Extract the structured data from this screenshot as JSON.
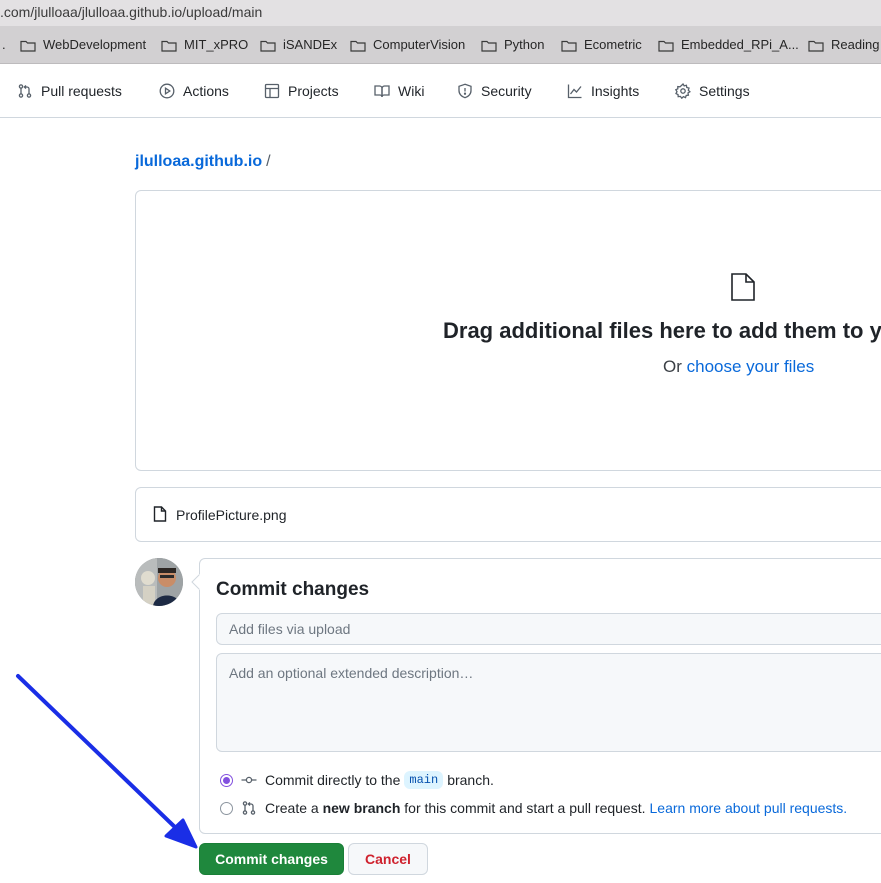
{
  "browser": {
    "url": ".com/jlulloaa/jlulloaa.github.io/upload/main",
    "bookmarks": [
      {
        "label": "WebDevelopment"
      },
      {
        "label": "MIT_xPRO"
      },
      {
        "label": "iSANDEx"
      },
      {
        "label": "ComputerVision"
      },
      {
        "label": "Python"
      },
      {
        "label": "Ecometric"
      },
      {
        "label": "Embedded_RPi_A..."
      },
      {
        "label": "Reading"
      }
    ]
  },
  "repo_nav": {
    "items": [
      {
        "label": "Pull requests",
        "icon": "git-pull-request-icon"
      },
      {
        "label": "Actions",
        "icon": "play-icon"
      },
      {
        "label": "Projects",
        "icon": "table-icon"
      },
      {
        "label": "Wiki",
        "icon": "book-icon"
      },
      {
        "label": "Security",
        "icon": "shield-icon"
      },
      {
        "label": "Insights",
        "icon": "graph-icon"
      },
      {
        "label": "Settings",
        "icon": "gear-icon"
      }
    ]
  },
  "breadcrumb": {
    "repo": "jlulloaa.github.io",
    "separator": "/"
  },
  "dropzone": {
    "title": "Drag additional files here to add them to y",
    "or_text": "Or",
    "choose_link": "choose your files"
  },
  "files": [
    {
      "name": "ProfilePicture.png"
    }
  ],
  "commit": {
    "title": "Commit changes",
    "summary_placeholder": "Add files via upload",
    "description_placeholder": "Add an optional extended description…",
    "option_direct": {
      "prefix": "Commit directly to the",
      "branch": "main",
      "suffix": "branch."
    },
    "option_new_branch": {
      "prefix": "Create a",
      "bold": "new branch",
      "suffix": "for this commit and start a pull request.",
      "link": "Learn more about pull requests."
    },
    "commit_button": "Commit changes",
    "cancel_button": "Cancel"
  },
  "colors": {
    "primary_button": "#1f883d",
    "link": "#0969da",
    "cancel_text": "#cf222e",
    "radio_selected": "#8250df",
    "annotation_arrow": "#1a2ee6"
  }
}
